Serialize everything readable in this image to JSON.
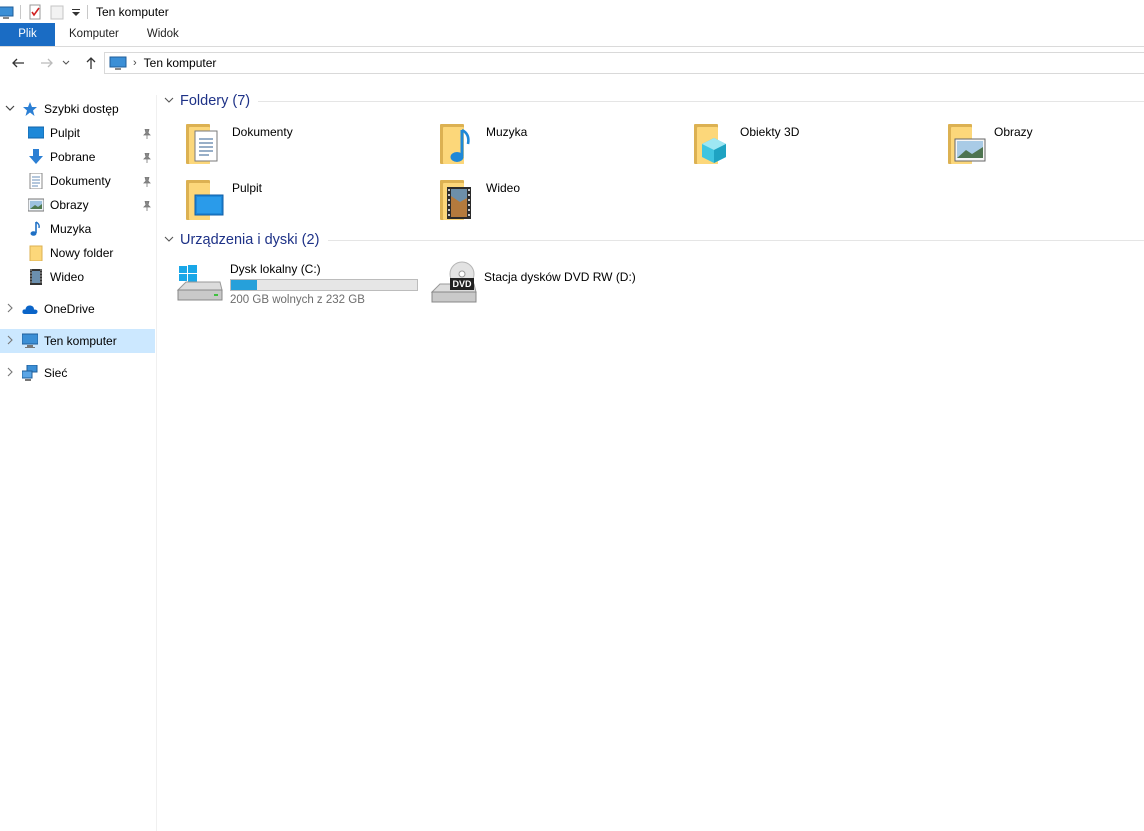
{
  "window": {
    "title": "Ten komputer"
  },
  "ribbon": {
    "tabs": [
      "Plik",
      "Komputer",
      "Widok"
    ]
  },
  "address": {
    "path": "Ten komputer"
  },
  "sidebar": {
    "quick_access": "Szybki dostęp",
    "quick_items": [
      {
        "label": "Pulpit",
        "pinned": true,
        "icon": "desktop-icon"
      },
      {
        "label": "Pobrane",
        "pinned": true,
        "icon": "download-icon"
      },
      {
        "label": "Dokumenty",
        "pinned": true,
        "icon": "documents-icon"
      },
      {
        "label": "Obrazy",
        "pinned": true,
        "icon": "pictures-icon"
      },
      {
        "label": "Muzyka",
        "pinned": false,
        "icon": "music-icon"
      },
      {
        "label": "Nowy folder",
        "pinned": false,
        "icon": "folder-icon"
      },
      {
        "label": "Wideo",
        "pinned": false,
        "icon": "video-icon"
      }
    ],
    "onedrive": "OneDrive",
    "this_pc": "Ten komputer",
    "network": "Sieć"
  },
  "main": {
    "folders_header": "Foldery (7)",
    "folders": [
      "Dokumenty",
      "Muzyka",
      "Obiekty 3D",
      "Obrazy",
      "Pulpit",
      "Wideo"
    ],
    "devices_header": "Urządzenia i dyski (2)",
    "drives": [
      {
        "name": "Dysk lokalny (C:)",
        "free": "200 GB wolnych z 232 GB",
        "used_fraction": 0.138
      },
      {
        "name": "Stacja dysków DVD RW (D:)"
      }
    ],
    "dvd_label": "DVD"
  },
  "colors": {
    "accent": "#1a6cc4",
    "selection": "#cce8ff",
    "header_text": "#1e3287",
    "drive_fill": "#26a0da"
  }
}
